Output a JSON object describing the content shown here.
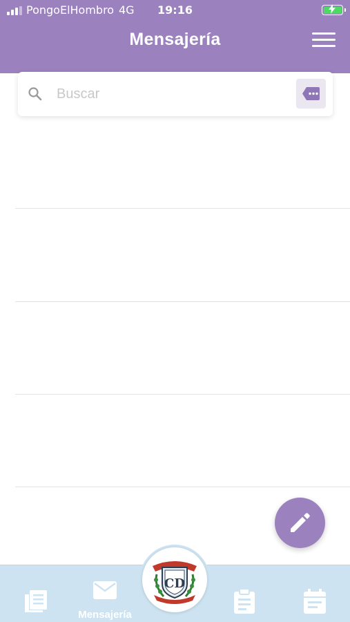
{
  "status_bar": {
    "carrier": "PongoElHombro",
    "network": "4G",
    "time": "19:16"
  },
  "header": {
    "title": "Mensajería",
    "menu_icon": "hamburger-menu-icon"
  },
  "search": {
    "placeholder": "Buscar",
    "value": "",
    "icon": "search-icon",
    "tag_icon": "tag-dots-icon"
  },
  "messages": [
    {},
    {},
    {},
    {}
  ],
  "fab": {
    "icon": "pencil-icon"
  },
  "bottom_nav": {
    "items": [
      {
        "icon": "news-icon",
        "label": ""
      },
      {
        "icon": "envelope-icon",
        "label": "Mensajería",
        "active": true
      },
      {
        "icon": "school-logo",
        "label": ""
      },
      {
        "icon": "clipboard-icon",
        "label": ""
      },
      {
        "icon": "calendar-icon",
        "label": ""
      }
    ]
  },
  "colors": {
    "primary": "#9b82bf",
    "nav_background": "#cde3f1",
    "battery": "#4cd964"
  }
}
